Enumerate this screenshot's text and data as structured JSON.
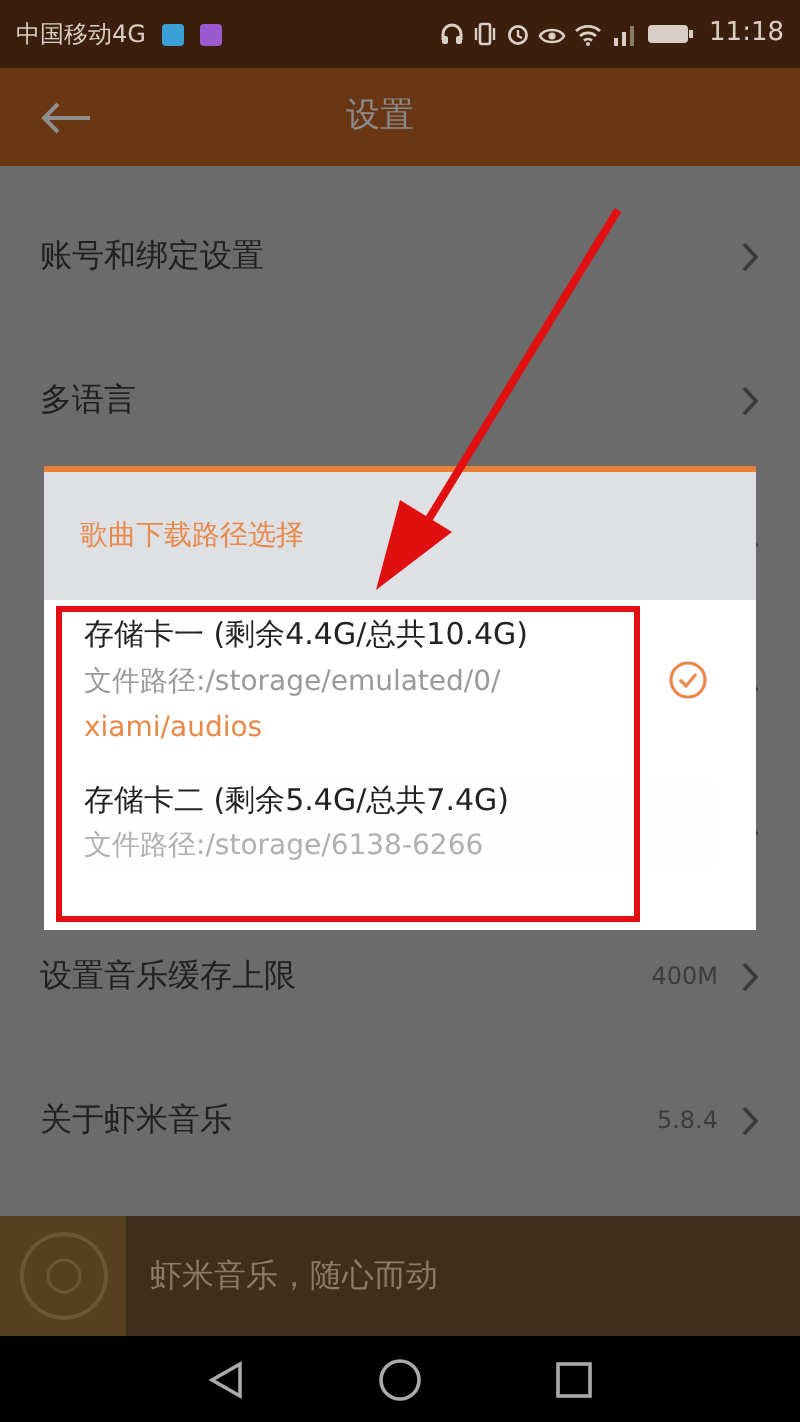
{
  "status_bar": {
    "carrier": "中国移动4G",
    "time": "11:18"
  },
  "header": {
    "title": "设置"
  },
  "settings": [
    {
      "label": "账号和绑定设置"
    },
    {
      "label": "多语言"
    },
    {
      "label": "设置音乐缓存上限",
      "value": "400M"
    },
    {
      "label": "关于虾米音乐",
      "value": "5.8.4"
    }
  ],
  "dialog": {
    "title": "歌曲下载路径选择",
    "options": [
      {
        "name": "存储卡一 (剩余4.4G/总共10.4G)",
        "path": "文件路径:/storage/emulated/0/",
        "path_highlight": "xiami/audios",
        "selected": true
      },
      {
        "name": "存储卡二 (剩余5.4G/总共7.4G)",
        "path": "文件路径:/storage/6138-6266",
        "selected": false
      }
    ]
  },
  "player_bar": {
    "slogan": "虾米音乐，随心而动"
  }
}
